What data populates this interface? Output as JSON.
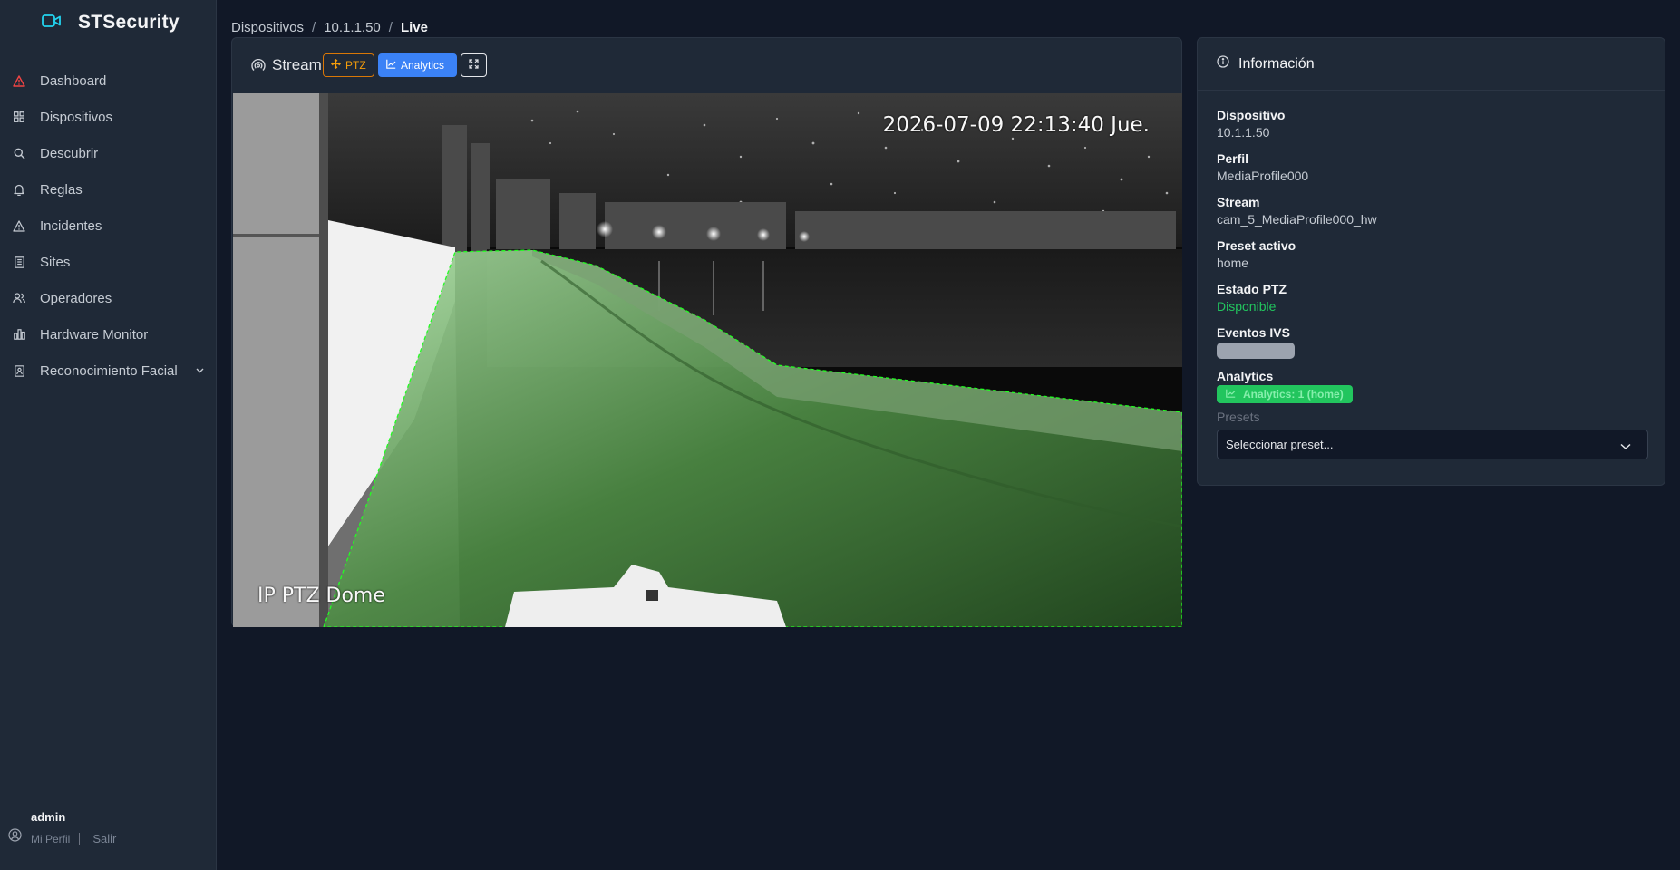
{
  "app": {
    "name": "STSecurity"
  },
  "sidebar": {
    "items": [
      {
        "label": "Dashboard",
        "icon": "alert-triangle-icon"
      },
      {
        "label": "Dispositivos",
        "icon": "grid-icon"
      },
      {
        "label": "Descubrir",
        "icon": "search-icon"
      },
      {
        "label": "Reglas",
        "icon": "bell-icon"
      },
      {
        "label": "Incidentes",
        "icon": "alert-triangle-icon"
      },
      {
        "label": "Sites",
        "icon": "building-icon"
      },
      {
        "label": "Operadores",
        "icon": "users-icon"
      },
      {
        "label": "Hardware Monitor",
        "icon": "bar-chart-icon"
      },
      {
        "label": "Reconocimiento Facial",
        "icon": "id-card-icon"
      }
    ],
    "user": {
      "name": "admin",
      "profile_link": "Mi Perfil",
      "logout_link": "Salir"
    }
  },
  "breadcrumb": {
    "root": "Dispositivos",
    "device": "10.1.1.50",
    "current": "Live"
  },
  "stream": {
    "title": "Stream",
    "ptz_label": "PTZ",
    "analytics_label": "Analytics",
    "osd_timestamp": "2026-07-09 22:13:40 Jue.",
    "osd_camera_label": "IP PTZ Dome"
  },
  "info": {
    "title": "Información",
    "fields": {
      "device_label": "Dispositivo",
      "device_value": "10.1.1.50",
      "profile_label": "Perfil",
      "profile_value": "MediaProfile000",
      "stream_label": "Stream",
      "stream_value": "cam_5_MediaProfile000_hw",
      "preset_label": "Preset activo",
      "preset_value": "home",
      "ptz_label": "Estado PTZ",
      "ptz_value": "Disponible",
      "ivs_label": "Eventos IVS",
      "analytics_label": "Analytics",
      "analytics_value": "Analytics: 1 (home)"
    },
    "presets_label": "Presets",
    "preset_select": "Seleccionar preset..."
  },
  "colors": {
    "accent_cyan": "#22d3ee",
    "danger": "#ef4444",
    "success": "#22c55e",
    "primary": "#3b82f6",
    "warning": "#f59e0b"
  }
}
